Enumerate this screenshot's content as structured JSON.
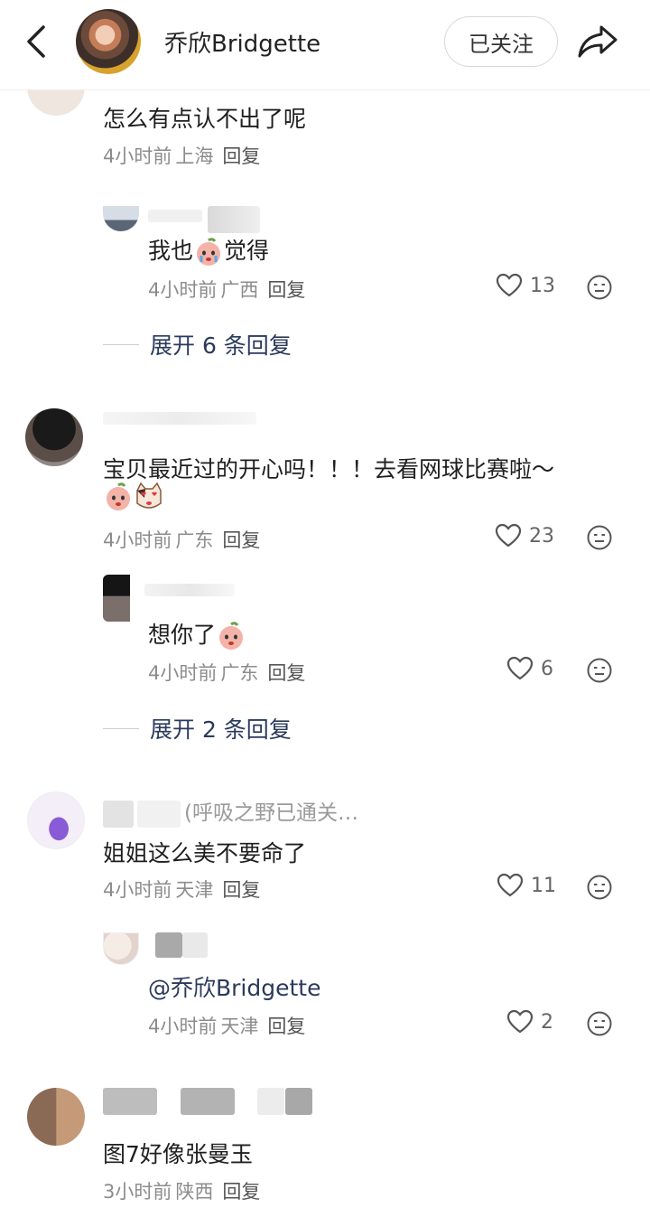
{
  "header": {
    "username": "乔欣Bridgette",
    "follow_label": "已关注"
  },
  "comments": [
    {
      "text": "怎么有点认不出了呢",
      "time": "4小时前",
      "location": "上海",
      "reply_label": "回复",
      "replies": [
        {
          "text_before": "我也",
          "text_after": "觉得",
          "time": "4小时前",
          "location": "广西",
          "reply_label": "回复",
          "likes": "13"
        }
      ],
      "expand_label": "展开 6 条回复"
    },
    {
      "text": "宝贝最近过的开心吗！！！去看网球比赛啦～",
      "time": "4小时前",
      "location": "广东",
      "reply_label": "回复",
      "likes": "23",
      "replies": [
        {
          "text": "想你了",
          "time": "4小时前",
          "location": "广东",
          "reply_label": "回复",
          "likes": "6"
        }
      ],
      "expand_label": "展开 2 条回复"
    },
    {
      "name_partial": "(呼吸之野已通关…",
      "text": "姐姐这么美不要命了",
      "time": "4小时前",
      "location": "天津",
      "reply_label": "回复",
      "likes": "11",
      "replies": [
        {
          "text": "@乔欣Bridgette",
          "time": "4小时前",
          "location": "天津",
          "reply_label": "回复",
          "likes": "2"
        }
      ]
    },
    {
      "text": "图7好像张曼玉",
      "time": "3小时前",
      "location": "陕西",
      "reply_label": "回复"
    }
  ],
  "icons": {
    "back": "chevron-left-icon",
    "share": "share-arrow-icon",
    "like": "heart-outline-icon",
    "emoji": "emoji-face-icon"
  }
}
